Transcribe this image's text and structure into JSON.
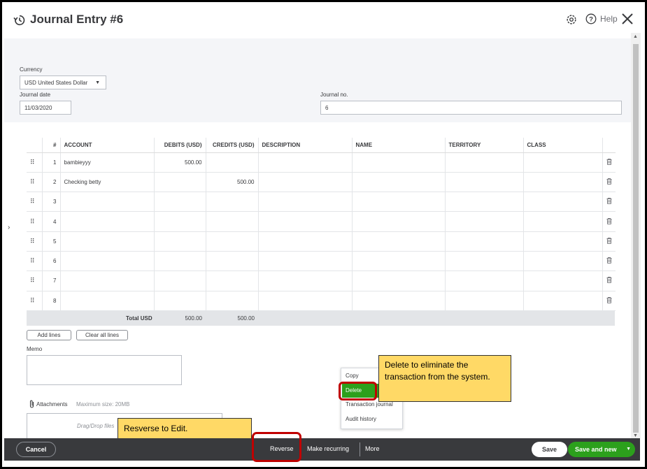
{
  "header": {
    "title": "Journal Entry #6",
    "help_label": "Help"
  },
  "form": {
    "currency_label": "Currency",
    "currency_value": "USD United States Dollar",
    "journal_date_label": "Journal date",
    "journal_date_value": "11/03/2020",
    "journal_no_label": "Journal no.",
    "journal_no_value": "6"
  },
  "table": {
    "columns": [
      "#",
      "ACCOUNT",
      "DEBITS (USD)",
      "CREDITS (USD)",
      "DESCRIPTION",
      "NAME",
      "TERRITORY",
      "CLASS"
    ],
    "rows": [
      {
        "num": "1",
        "account": "bambieyyy",
        "debit": "500.00",
        "credit": "",
        "description": "",
        "name": "",
        "territory": "",
        "class": ""
      },
      {
        "num": "2",
        "account": "Checking betty",
        "debit": "",
        "credit": "500.00",
        "description": "",
        "name": "",
        "territory": "",
        "class": ""
      },
      {
        "num": "3",
        "account": "",
        "debit": "",
        "credit": "",
        "description": "",
        "name": "",
        "territory": "",
        "class": ""
      },
      {
        "num": "4",
        "account": "",
        "debit": "",
        "credit": "",
        "description": "",
        "name": "",
        "territory": "",
        "class": ""
      },
      {
        "num": "5",
        "account": "",
        "debit": "",
        "credit": "",
        "description": "",
        "name": "",
        "territory": "",
        "class": ""
      },
      {
        "num": "6",
        "account": "",
        "debit": "",
        "credit": "",
        "description": "",
        "name": "",
        "territory": "",
        "class": ""
      },
      {
        "num": "7",
        "account": "",
        "debit": "",
        "credit": "",
        "description": "",
        "name": "",
        "territory": "",
        "class": ""
      },
      {
        "num": "8",
        "account": "",
        "debit": "",
        "credit": "",
        "description": "",
        "name": "",
        "territory": "",
        "class": ""
      }
    ],
    "total_label": "Total USD",
    "total_debits": "500.00",
    "total_credits": "500.00"
  },
  "actions": {
    "add_lines": "Add lines",
    "clear_all_lines": "Clear all lines"
  },
  "memo": {
    "label": "Memo"
  },
  "attachments": {
    "label": "Attachments",
    "max_size": "Maximum size: 20MB",
    "drop_hint": "Drag/Drop files"
  },
  "context_menu": {
    "items": [
      "Copy",
      "Delete",
      "Transaction journal",
      "Audit history"
    ]
  },
  "callouts": {
    "delete_note": "Delete to eliminate the transaction from the system.",
    "reverse_note": "Resverse to Edit."
  },
  "footer": {
    "cancel": "Cancel",
    "reverse": "Reverse",
    "make_recurring": "Make recurring",
    "more": "More",
    "save": "Save",
    "save_and_new": "Save and new"
  },
  "colors": {
    "brand_green": "#2ca01c",
    "footer_bg": "#393a3d",
    "highlight_red": "#c00000",
    "callout_yellow": "#ffd966"
  }
}
